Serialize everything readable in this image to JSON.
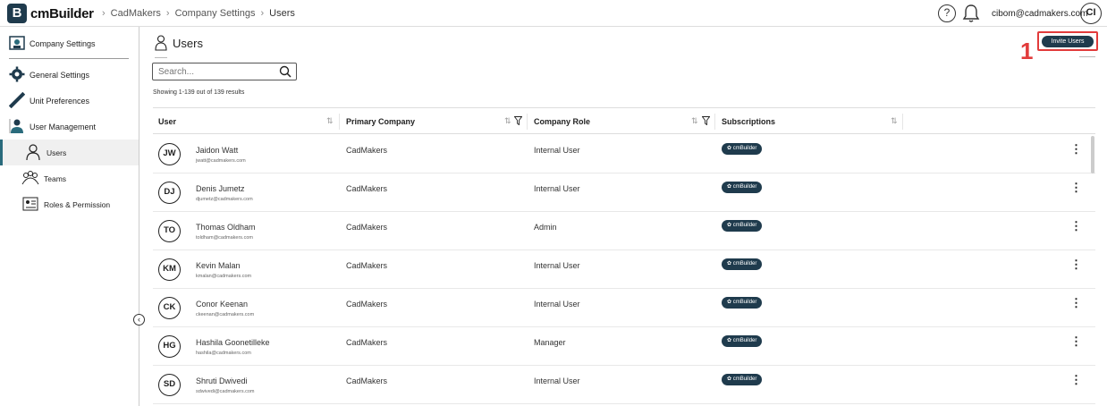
{
  "topbar": {
    "logo_letter": "B",
    "app_name": "cmBuilder",
    "breadcrumb": [
      "CadMakers",
      "Company Settings",
      "Users"
    ],
    "help_glyph": "?",
    "user_email": "cibom@cadmakers.com",
    "user_initials": "CI"
  },
  "sidebar": {
    "company_settings": "Company Settings",
    "general_settings": "General Settings",
    "unit_preferences": "Unit Preferences",
    "user_management": "User Management",
    "users": "Users",
    "teams": "Teams",
    "roles_permission": "Roles & Permission",
    "collapse_glyph": "‹"
  },
  "main": {
    "title": "Users",
    "search_placeholder": "Search...",
    "results_text": "Showing 1-139 out of 139 results",
    "invite_label": "Invite Users",
    "annotation_number": "1",
    "columns": [
      "User",
      "Primary Company",
      "Company Role",
      "Subscriptions"
    ],
    "sort_glyph": "⇅",
    "kebab_glyph": "⋮"
  },
  "users": [
    {
      "initials": "JW",
      "name": "Jaidon Watt",
      "email": "jwatt@cadmakers.com",
      "company": "CadMakers",
      "role": "Internal User",
      "subscription": "✿ cmBuilder"
    },
    {
      "initials": "DJ",
      "name": "Denis Jumetz",
      "email": "djumetz@cadmakers.com",
      "company": "CadMakers",
      "role": "Internal User",
      "subscription": "✿ cmBuilder"
    },
    {
      "initials": "TO",
      "name": "Thomas Oldham",
      "email": "toldham@cadmakers.com",
      "company": "CadMakers",
      "role": "Admin",
      "subscription": "✿ cmBuilder"
    },
    {
      "initials": "KM",
      "name": "Kevin Malan",
      "email": "kmalan@cadmakers.com",
      "company": "CadMakers",
      "role": "Internal User",
      "subscription": "✿ cmBuilder"
    },
    {
      "initials": "CK",
      "name": "Conor Keenan",
      "email": "ckeenan@cadmakers.com",
      "company": "CadMakers",
      "role": "Internal User",
      "subscription": "✿ cmBuilder"
    },
    {
      "initials": "HG",
      "name": "Hashila Goonetilleke",
      "email": "hashila@cadmakers.com",
      "company": "CadMakers",
      "role": "Manager",
      "subscription": "✿ cmBuilder"
    },
    {
      "initials": "SD",
      "name": "Shruti Dwivedi",
      "email": "sdwivedi@cadmakers.com",
      "company": "CadMakers",
      "role": "Internal User",
      "subscription": "✿ cmBuilder"
    }
  ],
  "colors": {
    "brand": "#1f3b4d",
    "accent": "#2a6b7c",
    "annotation": "#e23b3b"
  }
}
